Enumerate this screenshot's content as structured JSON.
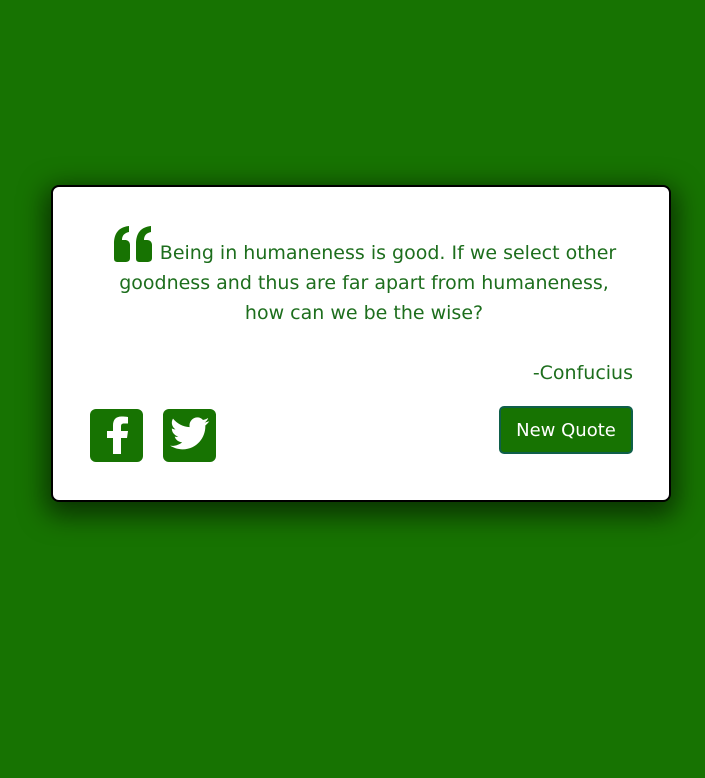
{
  "colors": {
    "background": "#177302",
    "card": "#ffffff",
    "text": "#1d6e1d",
    "button": "#177302"
  },
  "quote": {
    "icon": "quote-left-icon",
    "text": "Being in humaneness is good. If we select other goodness and thus are far apart from humaneness, how can we be the wise?",
    "author": "-Confucius"
  },
  "social": [
    {
      "name": "Facebook",
      "icon": "facebook-icon"
    },
    {
      "name": "Twitter",
      "icon": "twitter-icon"
    }
  ],
  "actions": {
    "new_quote_label": "New Quote"
  }
}
